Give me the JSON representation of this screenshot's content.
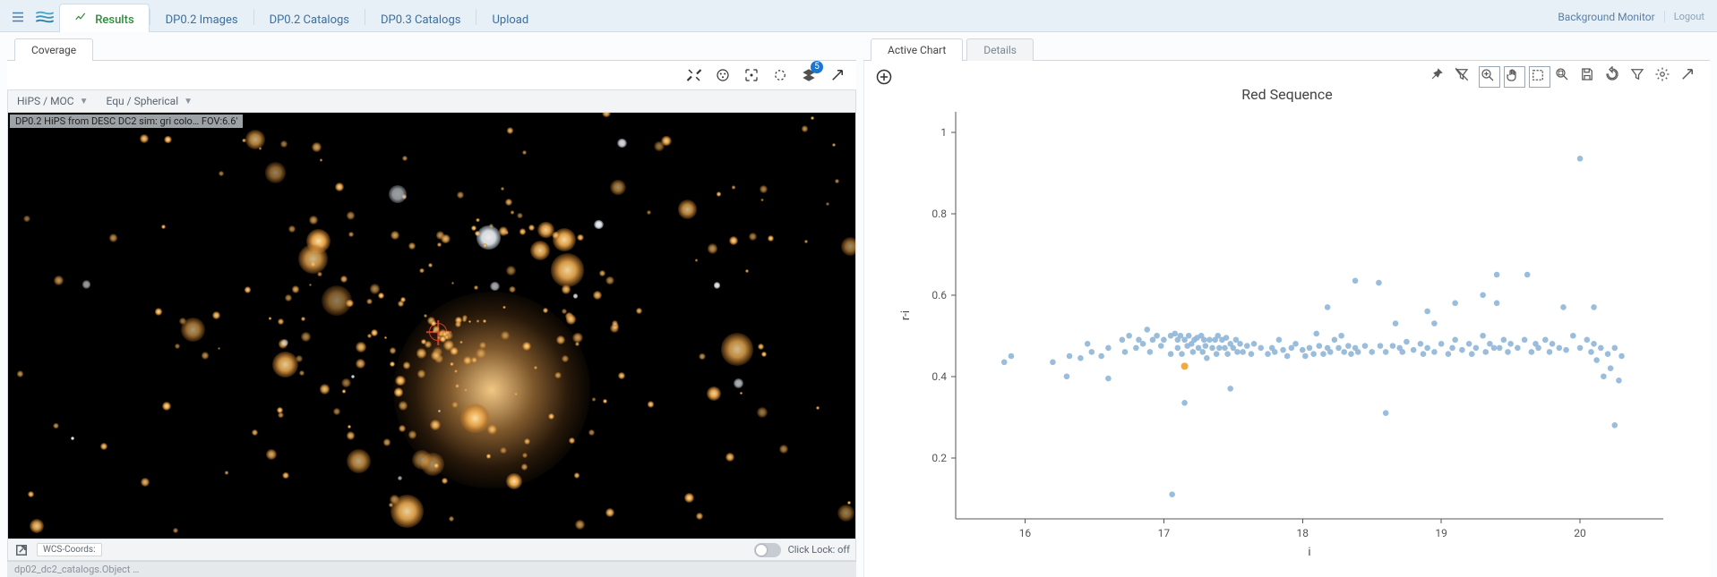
{
  "nav": {
    "tabs": [
      {
        "label": "Results",
        "active": true
      },
      {
        "label": "DP0.2 Images"
      },
      {
        "label": "DP0.2 Catalogs"
      },
      {
        "label": "DP0.3 Catalogs"
      },
      {
        "label": "Upload"
      }
    ],
    "right_links": {
      "bg_monitor": "Background Monitor",
      "logout": "Logout"
    }
  },
  "left": {
    "subtabs": [
      {
        "label": "Coverage",
        "active": true
      }
    ],
    "strip": {
      "hips": "HiPS / MOC",
      "proj": "Equ / Spherical"
    },
    "overlay_label": "DP0.2 HiPS from DESC DC2 sim: gri colo…   FOV:6.6'",
    "footer": {
      "wcs_label": "WCS-Coords:",
      "click_lock": "Click Lock: off"
    },
    "layers_badge": "5"
  },
  "right": {
    "subtabs": [
      {
        "label": "Active Chart",
        "active": true
      },
      {
        "label": "Details"
      }
    ]
  },
  "bottom_text": "dp02_dc2_catalogs.Object …",
  "chart_data": {
    "type": "scatter",
    "title": "Red Sequence",
    "xlabel": "i",
    "ylabel": "r-i",
    "xlim": [
      15.5,
      20.6
    ],
    "ylim": [
      0.05,
      1.05
    ],
    "xticks": [
      16,
      17,
      18,
      19,
      20
    ],
    "yticks": [
      0.2,
      0.4,
      0.6,
      0.8,
      1
    ],
    "highlight": {
      "x": 17.15,
      "y": 0.425
    },
    "points": [
      [
        15.85,
        0.435
      ],
      [
        15.9,
        0.45
      ],
      [
        16.2,
        0.435
      ],
      [
        16.3,
        0.4
      ],
      [
        16.32,
        0.45
      ],
      [
        16.4,
        0.445
      ],
      [
        16.45,
        0.48
      ],
      [
        16.48,
        0.46
      ],
      [
        16.55,
        0.45
      ],
      [
        16.6,
        0.47
      ],
      [
        16.6,
        0.395
      ],
      [
        16.7,
        0.49
      ],
      [
        16.72,
        0.46
      ],
      [
        16.75,
        0.5
      ],
      [
        16.8,
        0.47
      ],
      [
        16.82,
        0.49
      ],
      [
        16.85,
        0.48
      ],
      [
        16.88,
        0.515
      ],
      [
        16.9,
        0.46
      ],
      [
        16.92,
        0.49
      ],
      [
        16.95,
        0.5
      ],
      [
        16.98,
        0.475
      ],
      [
        17.0,
        0.49
      ],
      [
        17.05,
        0.5
      ],
      [
        17.05,
        0.455
      ],
      [
        17.06,
        0.11
      ],
      [
        17.08,
        0.505
      ],
      [
        17.1,
        0.47
      ],
      [
        17.1,
        0.49
      ],
      [
        17.12,
        0.5
      ],
      [
        17.13,
        0.455
      ],
      [
        17.15,
        0.49
      ],
      [
        17.15,
        0.335
      ],
      [
        17.17,
        0.475
      ],
      [
        17.18,
        0.5
      ],
      [
        17.2,
        0.48
      ],
      [
        17.21,
        0.46
      ],
      [
        17.22,
        0.49
      ],
      [
        17.24,
        0.495
      ],
      [
        17.25,
        0.47
      ],
      [
        17.27,
        0.5
      ],
      [
        17.28,
        0.46
      ],
      [
        17.29,
        0.49
      ],
      [
        17.3,
        0.475
      ],
      [
        17.31,
        0.445
      ],
      [
        17.33,
        0.49
      ],
      [
        17.35,
        0.47
      ],
      [
        17.37,
        0.49
      ],
      [
        17.38,
        0.455
      ],
      [
        17.39,
        0.5
      ],
      [
        17.4,
        0.47
      ],
      [
        17.42,
        0.49
      ],
      [
        17.44,
        0.47
      ],
      [
        17.45,
        0.495
      ],
      [
        17.46,
        0.455
      ],
      [
        17.48,
        0.48
      ],
      [
        17.48,
        0.37
      ],
      [
        17.5,
        0.47
      ],
      [
        17.52,
        0.49
      ],
      [
        17.53,
        0.46
      ],
      [
        17.55,
        0.48
      ],
      [
        17.57,
        0.46
      ],
      [
        17.6,
        0.475
      ],
      [
        17.63,
        0.455
      ],
      [
        17.65,
        0.48
      ],
      [
        17.7,
        0.47
      ],
      [
        17.75,
        0.455
      ],
      [
        17.78,
        0.47
      ],
      [
        17.8,
        0.46
      ],
      [
        17.83,
        0.49
      ],
      [
        17.86,
        0.465
      ],
      [
        17.89,
        0.45
      ],
      [
        17.92,
        0.47
      ],
      [
        17.95,
        0.48
      ],
      [
        18.0,
        0.465
      ],
      [
        18.02,
        0.45
      ],
      [
        18.05,
        0.47
      ],
      [
        18.08,
        0.455
      ],
      [
        18.1,
        0.505
      ],
      [
        18.12,
        0.475
      ],
      [
        18.15,
        0.455
      ],
      [
        18.18,
        0.57
      ],
      [
        18.18,
        0.47
      ],
      [
        18.2,
        0.46
      ],
      [
        18.23,
        0.49
      ],
      [
        18.26,
        0.47
      ],
      [
        18.28,
        0.5
      ],
      [
        18.3,
        0.46
      ],
      [
        18.33,
        0.475
      ],
      [
        18.35,
        0.455
      ],
      [
        18.38,
        0.635
      ],
      [
        18.38,
        0.47
      ],
      [
        18.4,
        0.46
      ],
      [
        18.45,
        0.475
      ],
      [
        18.5,
        0.46
      ],
      [
        18.55,
        0.63
      ],
      [
        18.56,
        0.475
      ],
      [
        18.6,
        0.46
      ],
      [
        18.6,
        0.31
      ],
      [
        18.65,
        0.475
      ],
      [
        18.67,
        0.53
      ],
      [
        18.7,
        0.47
      ],
      [
        18.72,
        0.46
      ],
      [
        18.75,
        0.485
      ],
      [
        18.8,
        0.465
      ],
      [
        18.85,
        0.48
      ],
      [
        18.87,
        0.455
      ],
      [
        18.9,
        0.47
      ],
      [
        18.9,
        0.56
      ],
      [
        18.95,
        0.46
      ],
      [
        18.95,
        0.53
      ],
      [
        19.0,
        0.48
      ],
      [
        19.05,
        0.455
      ],
      [
        19.08,
        0.47
      ],
      [
        19.1,
        0.49
      ],
      [
        19.1,
        0.58
      ],
      [
        19.15,
        0.465
      ],
      [
        19.2,
        0.48
      ],
      [
        19.22,
        0.455
      ],
      [
        19.25,
        0.47
      ],
      [
        19.3,
        0.5
      ],
      [
        19.3,
        0.6
      ],
      [
        19.32,
        0.46
      ],
      [
        19.35,
        0.48
      ],
      [
        19.38,
        0.47
      ],
      [
        19.4,
        0.65
      ],
      [
        19.4,
        0.58
      ],
      [
        19.42,
        0.47
      ],
      [
        19.45,
        0.49
      ],
      [
        19.48,
        0.46
      ],
      [
        19.5,
        0.48
      ],
      [
        19.55,
        0.47
      ],
      [
        19.6,
        0.49
      ],
      [
        19.62,
        0.65
      ],
      [
        19.65,
        0.46
      ],
      [
        19.68,
        0.48
      ],
      [
        19.7,
        0.47
      ],
      [
        19.75,
        0.49
      ],
      [
        19.78,
        0.46
      ],
      [
        19.8,
        0.48
      ],
      [
        19.85,
        0.47
      ],
      [
        19.88,
        0.57
      ],
      [
        19.9,
        0.465
      ],
      [
        19.95,
        0.5
      ],
      [
        20.0,
        0.47
      ],
      [
        20.0,
        0.935
      ],
      [
        20.05,
        0.49
      ],
      [
        20.08,
        0.46
      ],
      [
        20.1,
        0.48
      ],
      [
        20.1,
        0.57
      ],
      [
        20.12,
        0.44
      ],
      [
        20.15,
        0.47
      ],
      [
        20.17,
        0.4
      ],
      [
        20.2,
        0.455
      ],
      [
        20.22,
        0.42
      ],
      [
        20.25,
        0.47
      ],
      [
        20.25,
        0.28
      ],
      [
        20.28,
        0.39
      ],
      [
        20.3,
        0.45
      ]
    ]
  }
}
